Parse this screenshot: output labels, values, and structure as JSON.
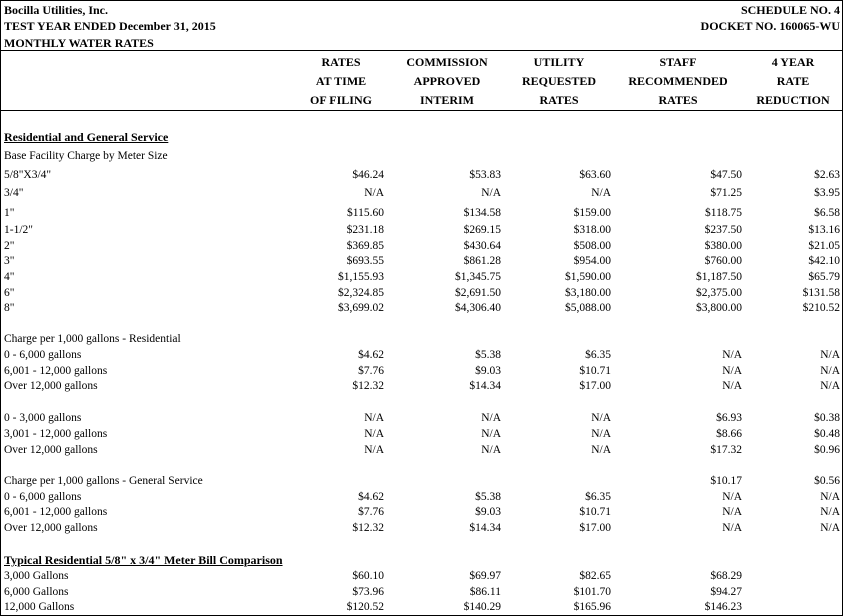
{
  "header": {
    "company": "Bocilla Utilities, Inc.",
    "test_year": "TEST YEAR ENDED December 31, 2015",
    "title": "MONTHLY WATER RATES",
    "schedule": "SCHEDULE NO. 4",
    "docket": "DOCKET NO. 160065-WU"
  },
  "columns": [
    {
      "line1": "RATES",
      "line2": "AT TIME",
      "line3": "OF FILING"
    },
    {
      "line1": "COMMISSION",
      "line2": "APPROVED",
      "line3": "INTERIM"
    },
    {
      "line1": "UTILITY",
      "line2": "REQUESTED",
      "line3": "RATES"
    },
    {
      "line1": "STAFF",
      "line2": "RECOMMENDED",
      "line3": "RATES"
    },
    {
      "line1": "4 YEAR",
      "line2": "RATE",
      "line3": "REDUCTION"
    }
  ],
  "sections": {
    "residential_general": "Residential and General Service",
    "base_facility": "Base Facility Charge by Meter Size",
    "charge_residential": "Charge per 1,000 gallons - Residential",
    "charge_general": "Charge per 1,000 gallons - General Service",
    "typical_bill": "Typical Residential 5/8\" x 3/4\" Meter Bill Comparison"
  },
  "base_facility_rows": [
    {
      "label": "5/8\"X3/4\"",
      "v": [
        "$46.24",
        "$53.83",
        "$63.60",
        "$47.50",
        "$2.63"
      ]
    },
    {
      "label": "3/4\"",
      "v": [
        "N/A",
        "N/A",
        "N/A",
        "$71.25",
        "$3.95"
      ]
    },
    {
      "label": "1\"",
      "v": [
        "$115.60",
        "$134.58",
        "$159.00",
        "$118.75",
        "$6.58"
      ]
    },
    {
      "label": "1-1/2\"",
      "v": [
        "$231.18",
        "$269.15",
        "$318.00",
        "$237.50",
        "$13.16"
      ]
    },
    {
      "label": "2\"",
      "v": [
        "$369.85",
        "$430.64",
        "$508.00",
        "$380.00",
        "$21.05"
      ]
    },
    {
      "label": "3\"",
      "v": [
        "$693.55",
        "$861.28",
        "$954.00",
        "$760.00",
        "$42.10"
      ]
    },
    {
      "label": "4\"",
      "v": [
        "$1,155.93",
        "$1,345.75",
        "$1,590.00",
        "$1,187.50",
        "$65.79"
      ]
    },
    {
      "label": "6\"",
      "v": [
        "$2,324.85",
        "$2,691.50",
        "$3,180.00",
        "$2,375.00",
        "$131.58"
      ]
    },
    {
      "label": "8\"",
      "v": [
        "$3,699.02",
        "$4,306.40",
        "$5,088.00",
        "$3,800.00",
        "$210.52"
      ]
    }
  ],
  "residential_rows_a": [
    {
      "label": "0 - 6,000 gallons",
      "v": [
        "$4.62",
        "$5.38",
        "$6.35",
        "N/A",
        "N/A"
      ]
    },
    {
      "label": "6,001 - 12,000 gallons",
      "v": [
        "$7.76",
        "$9.03",
        "$10.71",
        "N/A",
        "N/A"
      ]
    },
    {
      "label": "Over 12,000 gallons",
      "v": [
        "$12.32",
        "$14.34",
        "$17.00",
        "N/A",
        "N/A"
      ]
    }
  ],
  "residential_rows_b": [
    {
      "label": "0 - 3,000 gallons",
      "v": [
        "N/A",
        "N/A",
        "N/A",
        "$6.93",
        "$0.38"
      ]
    },
    {
      "label": "3,001 - 12,000 gallons",
      "v": [
        "N/A",
        "N/A",
        "N/A",
        "$8.66",
        "$0.48"
      ]
    },
    {
      "label": "Over 12,000 gallons",
      "v": [
        "N/A",
        "N/A",
        "N/A",
        "$17.32",
        "$0.96"
      ]
    }
  ],
  "general_header_values": [
    "",
    "",
    "",
    "$10.17",
    "$0.56"
  ],
  "general_rows": [
    {
      "label": "0 - 6,000 gallons",
      "v": [
        "$4.62",
        "$5.38",
        "$6.35",
        "N/A",
        "N/A"
      ]
    },
    {
      "label": "6,001 - 12,000 gallons",
      "v": [
        "$7.76",
        "$9.03",
        "$10.71",
        "N/A",
        "N/A"
      ]
    },
    {
      "label": "Over 12,000 gallons",
      "v": [
        "$12.32",
        "$14.34",
        "$17.00",
        "N/A",
        "N/A"
      ]
    }
  ],
  "bill_rows": [
    {
      "label": "3,000 Gallons",
      "v": [
        "$60.10",
        "$69.97",
        "$82.65",
        "$68.29",
        ""
      ]
    },
    {
      "label": "6,000 Gallons",
      "v": [
        "$73.96",
        "$86.11",
        "$101.70",
        "$94.27",
        ""
      ]
    },
    {
      "label": "12,000 Gallons",
      "v": [
        "$120.52",
        "$140.29",
        "$165.96",
        "$146.23",
        ""
      ]
    }
  ]
}
